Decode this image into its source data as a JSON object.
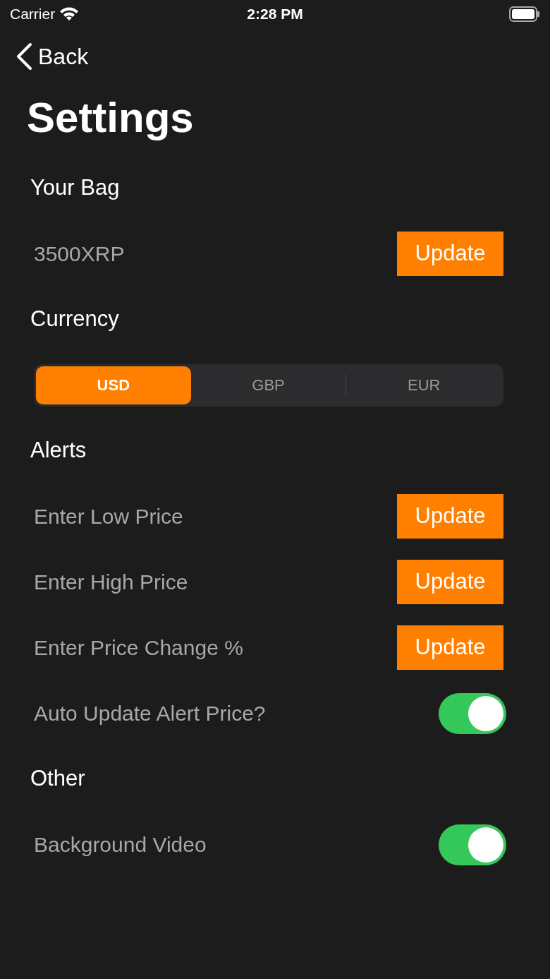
{
  "status_bar": {
    "carrier": "Carrier",
    "time": "2:28 PM"
  },
  "nav": {
    "back": "Back"
  },
  "title": "Settings",
  "sections": [
    {
      "heading": "Your Bag",
      "rows": [
        {
          "kind": "field",
          "placeholder": "3500XRP",
          "button": "Update"
        }
      ]
    },
    {
      "heading": "Currency",
      "rows": [
        {
          "kind": "segmented",
          "options": [
            {
              "label": "USD",
              "selected": true
            },
            {
              "label": "GBP",
              "selected": false
            },
            {
              "label": "EUR",
              "selected": false
            }
          ]
        }
      ]
    },
    {
      "heading": "Alerts",
      "rows": [
        {
          "kind": "field",
          "placeholder": "Enter Low Price",
          "button": "Update"
        },
        {
          "kind": "field",
          "placeholder": "Enter High Price",
          "button": "Update"
        },
        {
          "kind": "field",
          "placeholder": "Enter Price Change %",
          "button": "Update"
        },
        {
          "kind": "toggle",
          "label": "Auto Update Alert Price?",
          "on": true
        }
      ]
    },
    {
      "heading": "Other",
      "rows": [
        {
          "kind": "toggle",
          "label": "Background Video",
          "on": true
        }
      ]
    }
  ]
}
